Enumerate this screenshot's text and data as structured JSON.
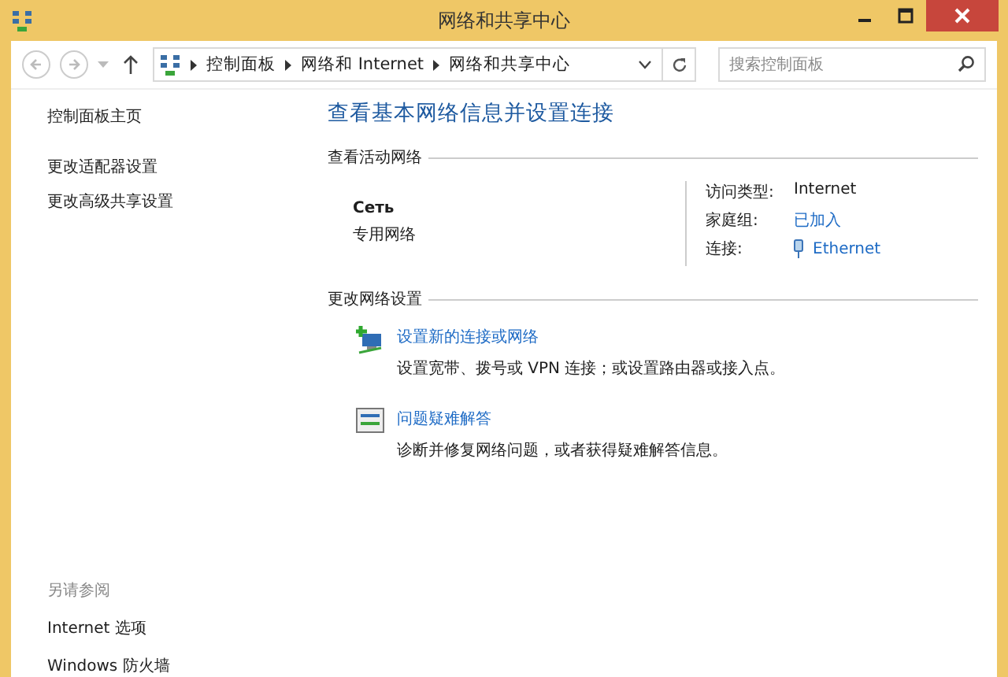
{
  "window": {
    "title": "网络和共享中心"
  },
  "address_bar": {
    "breadcrumbs": [
      "控制面板",
      "网络和 Internet",
      "网络和共享中心"
    ]
  },
  "search": {
    "placeholder": "搜索控制面板"
  },
  "sidebar": {
    "links": [
      "控制面板主页",
      "更改适配器设置",
      "更改高级共享设置"
    ],
    "see_also_heading": "另请参阅",
    "see_also": [
      "Internet 选项",
      "Windows 防火墙"
    ]
  },
  "main": {
    "heading": "查看基本网络信息并设置连接",
    "active_networks_heading": "查看活动网络",
    "network": {
      "name": "Сеть",
      "type": "专用网络",
      "access_type_label": "访问类型:",
      "access_type": "Internet",
      "homegroup_label": "家庭组:",
      "homegroup": "已加入",
      "connections_label": "连接:",
      "connection": "Ethernet"
    },
    "change_heading": "更改网络设置",
    "tasks": [
      {
        "kind": "new-connection",
        "title": "设置新的连接或网络",
        "description": "设置宽带、拨号或 VPN 连接；或设置路由器或接入点。"
      },
      {
        "kind": "troubleshoot",
        "title": "问题疑难解答",
        "description": "诊断并修复网络问题，或者获得疑难解答信息。"
      }
    ]
  }
}
